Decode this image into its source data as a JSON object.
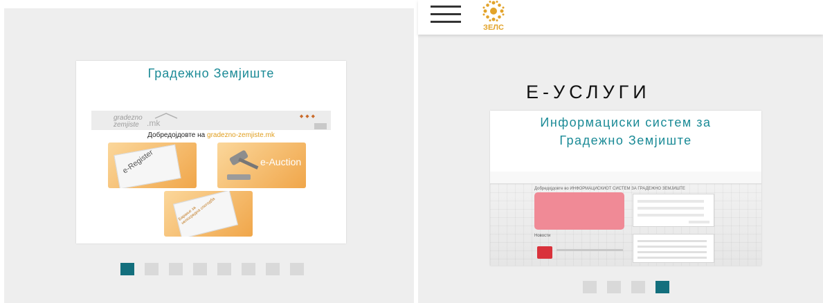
{
  "header": {
    "menu_icon": "hamburger-menu-icon",
    "logo_icon": "zels-sun-logo-icon",
    "logo_text": "ЗЕЛС",
    "logo_color": "#e2a32a"
  },
  "left_slider": {
    "title": "Градежно Земјиште",
    "site_logo_text": "gradezno zemjiste .mk",
    "welcome_prefix": "Добредојдовте на ",
    "welcome_domain": "gradezno-zemjiste.mk",
    "tiles": [
      "e-Register",
      "e-Auction",
      "Барање за непосредна спогодба"
    ],
    "active_index": 1,
    "dots": [
      true,
      false,
      false,
      false,
      false,
      false,
      false,
      false
    ]
  },
  "right_slider": {
    "section_title": "Е-УСЛУГИ",
    "card_title_line1": "Информациски систем за",
    "card_title_line2": "Градежно Земјиште",
    "screenshot_heading": "Добредојдовте во ИНФОРМАЦИСКИОТ СИСТЕМ ЗА ГРАДЕЖНО ЗЕМЈИШТЕ",
    "screenshot_news": "Новости",
    "active_index": 4,
    "dots": [
      false,
      false,
      false,
      true
    ]
  },
  "colors": {
    "accent_teal": "#1a8a96",
    "active_dot": "#136f7d",
    "inactive_dot": "#d9d9d9",
    "panel_bg": "#eeeeee"
  }
}
